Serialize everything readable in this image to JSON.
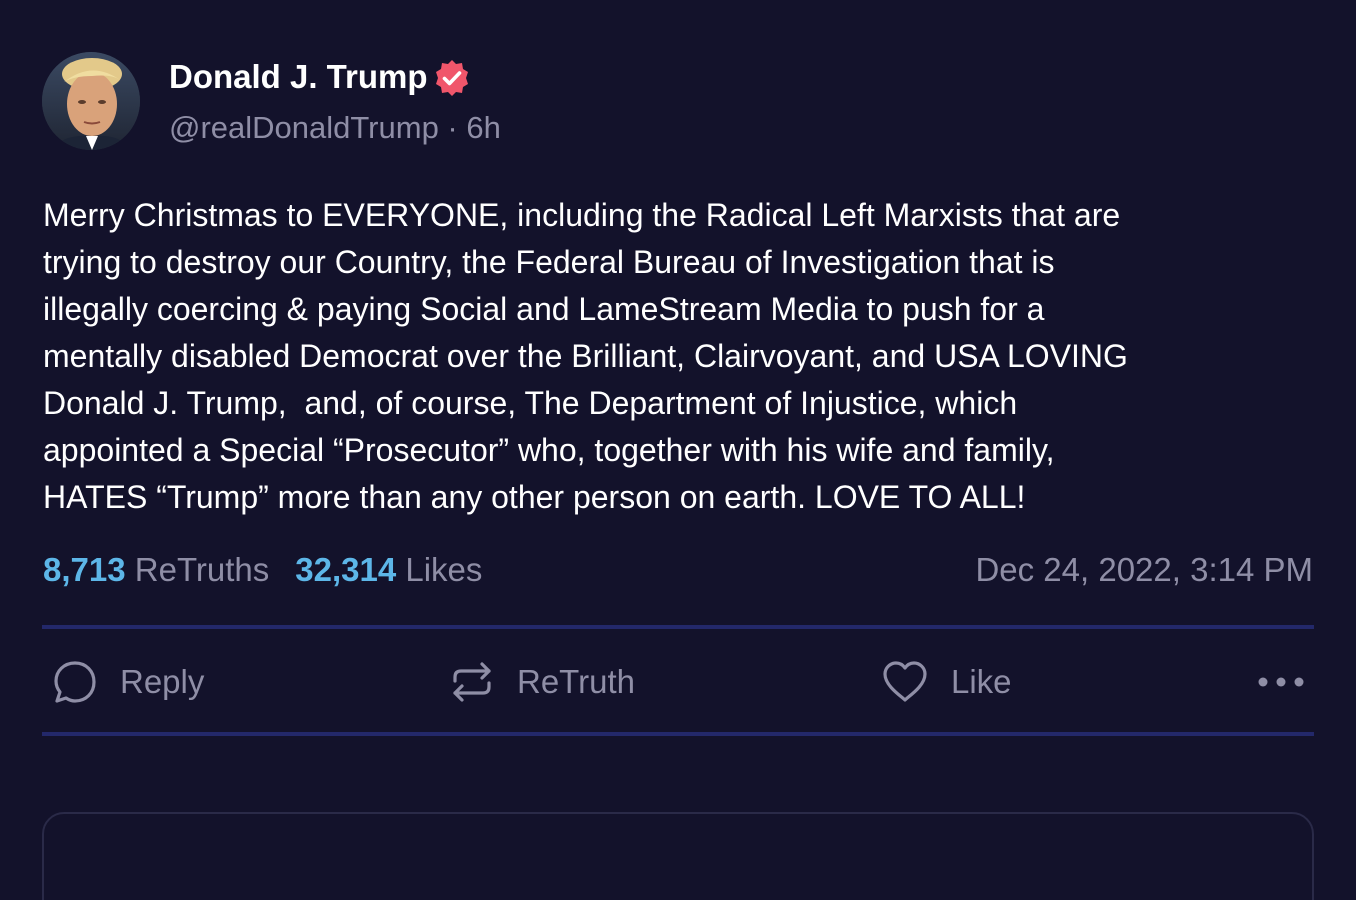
{
  "post": {
    "author": {
      "display_name": "Donald J. Trump",
      "verified_icon": "verified-badge-icon",
      "handle_line": "@realDonaldTrump · 6h"
    },
    "body": "Merry Christmas to EVERYONE, including the Radical Left Marxists that are\ntrying to destroy our Country, the Federal Bureau of Investigation that is\nillegally coercing & paying Social and LameStream Media to push for a\nmentally disabled Democrat over the Brilliant, Clairvoyant, and USA LOVING\nDonald J. Trump,  and, of course, The Department of Injustice, which\nappointed a Special “Prosecutor” who, together with his wife and family,\nHATES “Trump” more than any other person on earth. LOVE TO ALL!",
    "stats": {
      "retruths_count": "8,713",
      "retruths_label": "ReTruths",
      "likes_count": "32,314",
      "likes_label": "Likes"
    },
    "timestamp": "Dec 24, 2022, 3:14 PM"
  },
  "actions": {
    "reply_label": "Reply",
    "retruth_label": "ReTruth",
    "like_label": "Like",
    "more_icon": "more-horizontal-icon"
  },
  "colors": {
    "background": "#13122b",
    "accent_count": "#5db6e8",
    "muted_text": "#8f8ea6",
    "divider": "#23286a",
    "verified_badge": "#f0566b"
  }
}
